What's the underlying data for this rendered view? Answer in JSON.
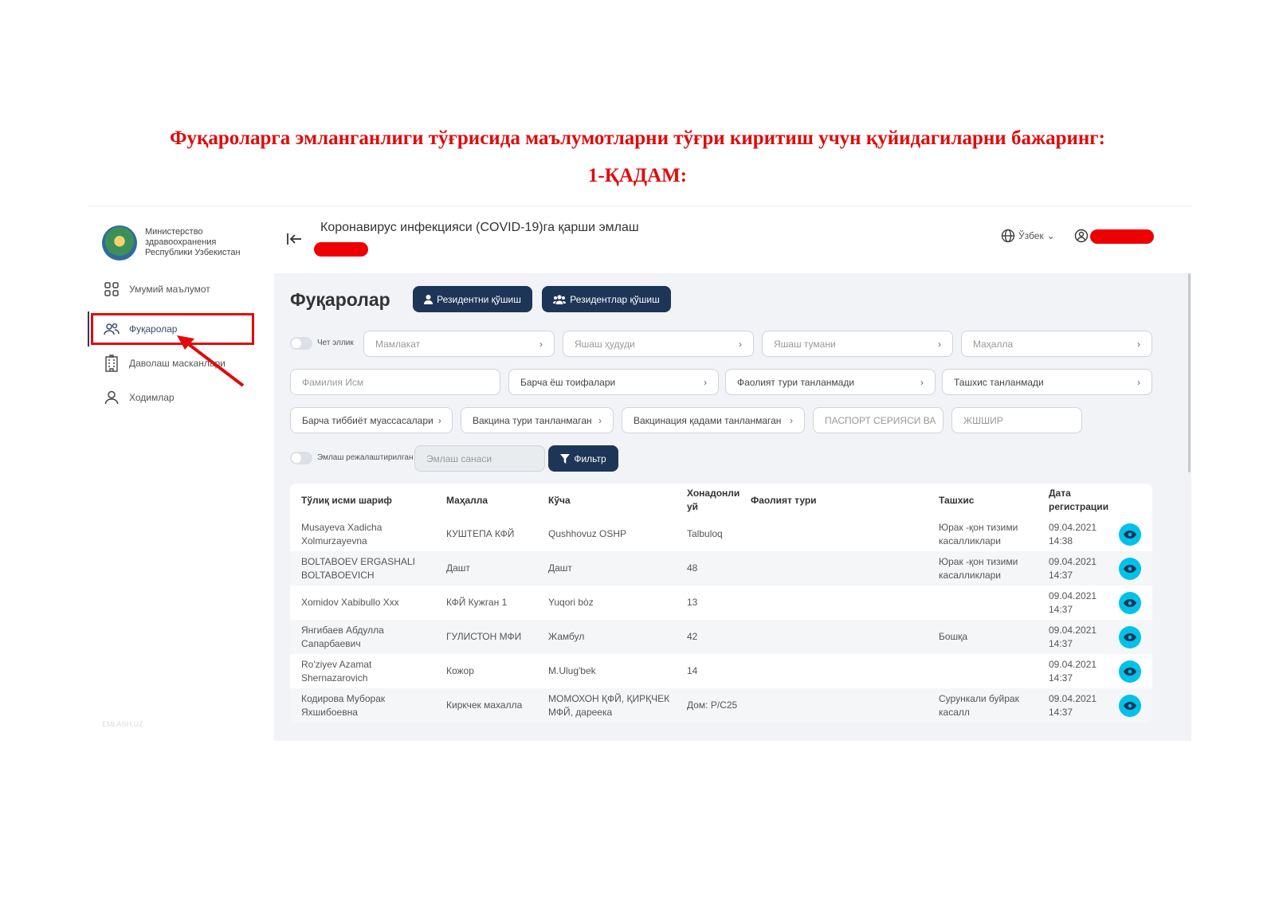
{
  "instruction": {
    "line1": "Фуқароларга эмланганлиги тўғрисида маълумотларни тўғри киритиш учун қуйидагиларни бажаринг:",
    "line2": "1-ҚАДАМ:"
  },
  "sidebar": {
    "org_lines": [
      "Министерство",
      "здравоохранения",
      "Республики Узбекистан"
    ],
    "items": [
      {
        "label": "Умумий маълумот",
        "icon": "grid-icon"
      },
      {
        "label": "Фуқаролар",
        "icon": "users-icon"
      },
      {
        "label": "Даволаш масканлари",
        "icon": "building-icon"
      },
      {
        "label": "Ходимлар",
        "icon": "user-icon"
      }
    ],
    "active_index": 1,
    "watermark": "EMLASH.UZ"
  },
  "header": {
    "title": "Коронавирус инфекцияси (COVID-19)га қарши эмлаш",
    "language": "Ўзбек"
  },
  "page": {
    "title": "Фуқаролар",
    "add_resident_label": "Резидентни қўшиш",
    "add_residents_label": "Резидентлар қўшиш"
  },
  "filters": {
    "foreigner_toggle": "Чет эллик",
    "country": "Мамлакат",
    "region": "Яшаш ҳудуди",
    "district": "Яшаш тумани",
    "mahalla": "Маҳалла",
    "full_name": "Фамилия Исм",
    "age_groups": "Барча ёш тоифалари",
    "activity": "Фаолият тури танланмади",
    "diagnosis": "Ташхис танланмади",
    "medical_institutions": "Барча тиббиёт муассасалари",
    "vaccine_type": "Вакцина тури танланмаган",
    "vaccination_step": "Вакцинация қадами танланмаган",
    "passport": "ПАСПОРТ СЕРИЯСИ ВА",
    "pinfl": "ЖШШИР",
    "scheduled_toggle": "Эмлаш режалаштирилган",
    "vaccination_date": "Эмлаш санаси",
    "filter_button": "Фильтр"
  },
  "table": {
    "headers": [
      "Тўлиқ исми шариф",
      "Маҳалла",
      "Кўча",
      "Хонадонли уй",
      "Фаолият тури",
      "Ташхис",
      "Дата регистрации"
    ],
    "rows": [
      {
        "name": "Musayeva Xadicha Xolmurzayevna",
        "mahalla": "КУШТЕПА КФЙ",
        "street": "Qushhovuz OSHP",
        "house": "Talbuloq",
        "activity": "",
        "diagnosis": "Юрак -қон тизими касалликлари",
        "date": "09.04.2021 14:38"
      },
      {
        "name": "BOLTABOEV ERGASHALI BOLTABOEVICH",
        "mahalla": "Дашт",
        "street": "Дашт",
        "house": "48",
        "activity": "",
        "diagnosis": "Юрак -қон тизими касалликлари",
        "date": "09.04.2021 14:37"
      },
      {
        "name": "Xomidov Xabibullo Xxx",
        "mahalla": "КФЙ Кужган 1",
        "street": "Yuqori bòz",
        "house": "13",
        "activity": "",
        "diagnosis": "",
        "date": "09.04.2021 14:37"
      },
      {
        "name": "Янгибаев Абдулла Сапарбаевич",
        "mahalla": "ГУЛИСТОН МФИ",
        "street": "Жамбул",
        "house": "42",
        "activity": "",
        "diagnosis": "Бошқа",
        "date": "09.04.2021 14:37"
      },
      {
        "name": "Ro'ziyev Azamat Shernazarovich",
        "mahalla": "Кожор",
        "street": "M.Ulug'bek",
        "house": "14",
        "activity": "",
        "diagnosis": "",
        "date": "09.04.2021 14:37"
      },
      {
        "name": "Кодирова Муборак Яхшибоевна",
        "mahalla": "Киркчек махалла",
        "street": "МОМОХОН ҚФЙ, ҚИРҚЧЕК МФЙ, дареека",
        "house": "Дом: Р/С25",
        "activity": "",
        "diagnosis": "Сурункали буйрак касалл",
        "date": "09.04.2021 14:37"
      }
    ]
  },
  "colors": {
    "accent_dark": "#1d3557",
    "highlight_red": "#e10b0b",
    "eye_button": "#00c2e8"
  }
}
